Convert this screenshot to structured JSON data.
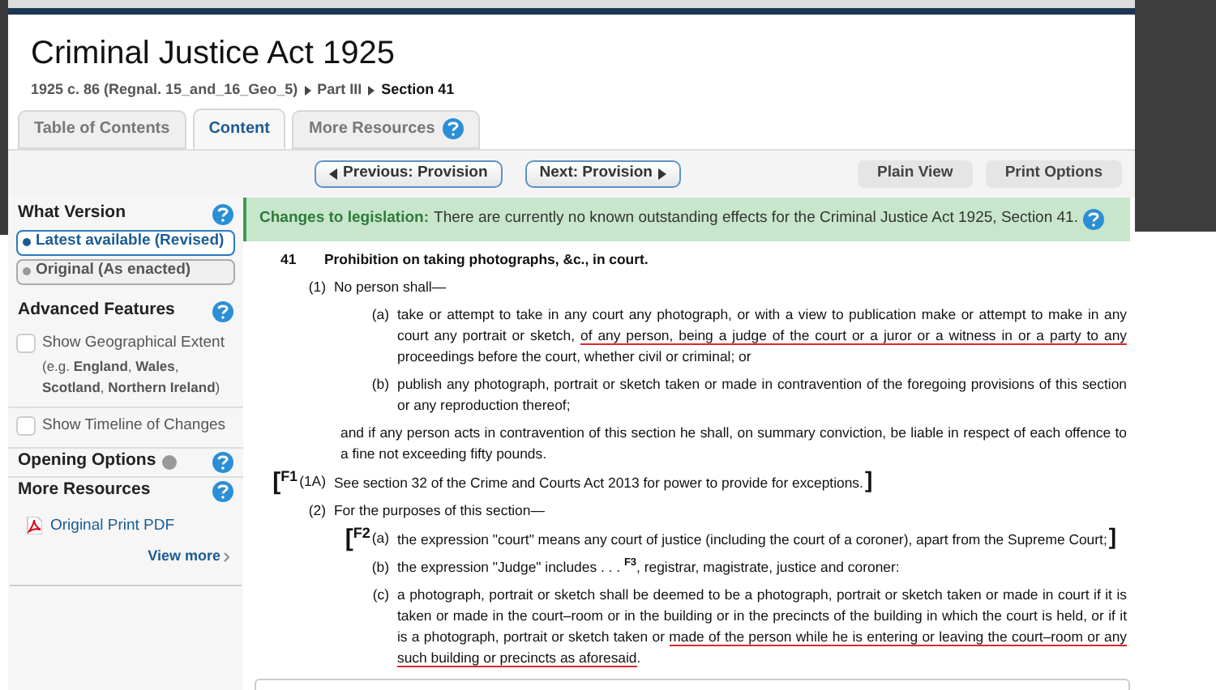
{
  "header": {
    "title": "Criminal Justice Act 1925",
    "breadcrumb": [
      {
        "text": "1925 c. 86 (Regnal. 15_and_16_Geo_5)",
        "current": false
      },
      {
        "text": "Part III",
        "current": false
      },
      {
        "text": "Section 41",
        "current": true
      }
    ]
  },
  "tabs": [
    {
      "label": "Table of Contents",
      "selected": false,
      "help": false
    },
    {
      "label": "Content",
      "selected": true,
      "help": false
    },
    {
      "label": "More Resources",
      "selected": false,
      "help": true
    }
  ],
  "toolbar": {
    "nav": [
      {
        "label": "Previous: Provision",
        "kind": "prev"
      },
      {
        "label": "Next: Provision",
        "kind": "next"
      }
    ],
    "actions": [
      "Plain View",
      "Print Options"
    ]
  },
  "sidebar": {
    "what_version": {
      "title": "What Version",
      "options": [
        {
          "label": "Latest available (Revised)",
          "selected": true
        },
        {
          "label": "Original (As enacted)",
          "selected": false
        }
      ]
    },
    "advanced_features": {
      "title": "Advanced Features",
      "options": [
        {
          "label": "Show Geographical Extent",
          "note": "(e.g. **England**, **Wales**, **Scotland**, **Northern Ireland**)",
          "checked": false
        },
        {
          "label": "Show Timeline of Changes",
          "checked": false
        }
      ]
    },
    "opening_options": {
      "title": "Opening Options"
    },
    "more_resources": {
      "title": "More Resources",
      "links": [
        "Original Print PDF"
      ],
      "view_more": "View more"
    }
  },
  "banner": {
    "label": "Changes to legislation:",
    "text": "There are currently no known outstanding effects for the Criminal Justice Act 1925, Section 41."
  },
  "section": {
    "number": "41",
    "heading": "Prohibition on taking photographs, &c., in court.",
    "blocks": [
      {
        "kind": "subsection",
        "number": "(1)",
        "segments": [
          {
            "text": "No person shall—",
            "underlined": false
          }
        ]
      },
      {
        "kind": "paragraph",
        "number": "(a)",
        "segments": [
          {
            "text": "take or attempt to take in any court any photograph, or with a view to publication make or attempt to make in any court any portrait or sketch, ",
            "underlined": false
          },
          {
            "text": "of any person, being a judge of the court or a juror or a witness in or a party to any",
            "underlined": true
          },
          {
            "text": " proceedings before the court, whether civil or criminal; or",
            "underlined": false
          }
        ]
      },
      {
        "kind": "paragraph",
        "number": "(b)",
        "segments": [
          {
            "text": "publish any photograph, portrait or sketch taken or made in contravention of the foregoing provisions of this section or any reproduction thereof;",
            "underlined": false
          }
        ]
      },
      {
        "kind": "text",
        "segments": [
          {
            "text": "and if any person acts in contravention of this section he shall, on summary conviction, be liable in respect of each offence to a fine not exceeding fifty pounds.",
            "underlined": false
          }
        ]
      },
      {
        "kind": "subsection",
        "open": "[",
        "footnote": "F1",
        "number": "(1A)",
        "segments": [
          {
            "text": "See section 32 of the Crime and Courts Act 2013 for power to provide for exceptions.",
            "underlined": false
          }
        ],
        "close": "]"
      },
      {
        "kind": "subsection",
        "number": "(2)",
        "segments": [
          {
            "text": "For the purposes of this section—",
            "underlined": false
          }
        ]
      },
      {
        "kind": "paragraph",
        "open": "[",
        "footnote": "F2",
        "number": "(a)",
        "segments": [
          {
            "text": "the expression \"court\" means any court of justice (including the court of a coroner), apart from the Supreme Court;",
            "underlined": false
          }
        ],
        "close": "]"
      },
      {
        "kind": "paragraph",
        "number": "(b)",
        "segments": [
          {
            "text": "the expression \"Judge\" includes . . . **$^{F3}$**, registrar, magistrate, justice and coroner:",
            "underlined": false
          }
        ]
      },
      {
        "kind": "paragraph",
        "number": "(c)",
        "segments": [
          {
            "text": "a photograph, portrait or sketch shall be deemed to be a photograph, portrait or sketch taken or made in court if it is taken or made in the court–room or in the building or in the precincts of the building in which the court is held, or if it is a photograph, portrait or sketch taken or ",
            "underlined": false
          },
          {
            "text": "made of the person while he is entering or leaving the court–room or any such building or precincts as aforesaid",
            "underlined": true
          },
          {
            "text": ".",
            "underlined": false
          }
        ]
      }
    ]
  }
}
